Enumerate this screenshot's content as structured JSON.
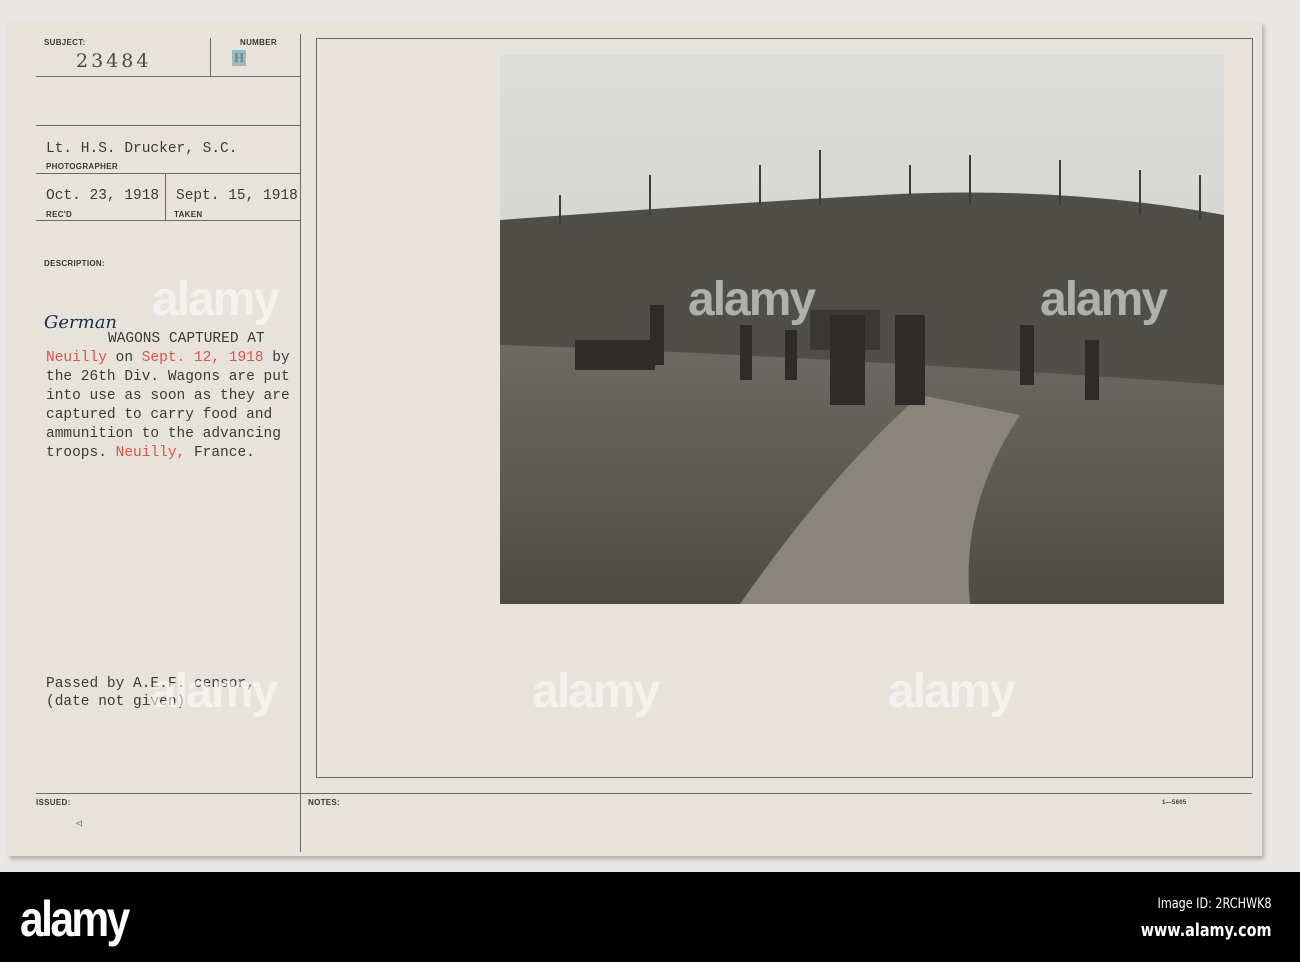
{
  "card": {
    "subject_label": "SUBJECT:",
    "subject_value": "23484",
    "number_label": "NUMBER",
    "number_stamp": "H",
    "photographer_value": "Lt. H.S. Drucker, S.C.",
    "photographer_label": "PHOTOGRAPHER",
    "received_value": "Oct. 23, 1918",
    "received_label": "REC'D",
    "taken_value": "Sept. 15, 1918",
    "taken_label": "TAKEN",
    "description_label": "DESCRIPTION:",
    "handwritten_word": "German",
    "description": {
      "line1": "WAGONS CAPTURED AT",
      "place1": "Neuilly",
      "on": " on ",
      "date": "Sept. 12, 1918",
      "by": " by",
      "line3": "the 26th Div. Wagons are put",
      "line4": "into use as soon as they are",
      "line5": "captured to carry food and",
      "line6": "ammunition to the advancing",
      "line7_start": "troops. ",
      "place2": "Neuilly,",
      "line7_end": " France."
    },
    "censor_line1": "Passed by A.E.F. censor,",
    "censor_line2": "(date not given)",
    "issued_label": "ISSUED:",
    "notes_label": "NOTES:",
    "form_number": "1—5605"
  },
  "watermark": "alamy",
  "footer": {
    "logo": "alamy",
    "image_id": "Image ID: 2RCHWK8",
    "url": "www.alamy.com"
  }
}
